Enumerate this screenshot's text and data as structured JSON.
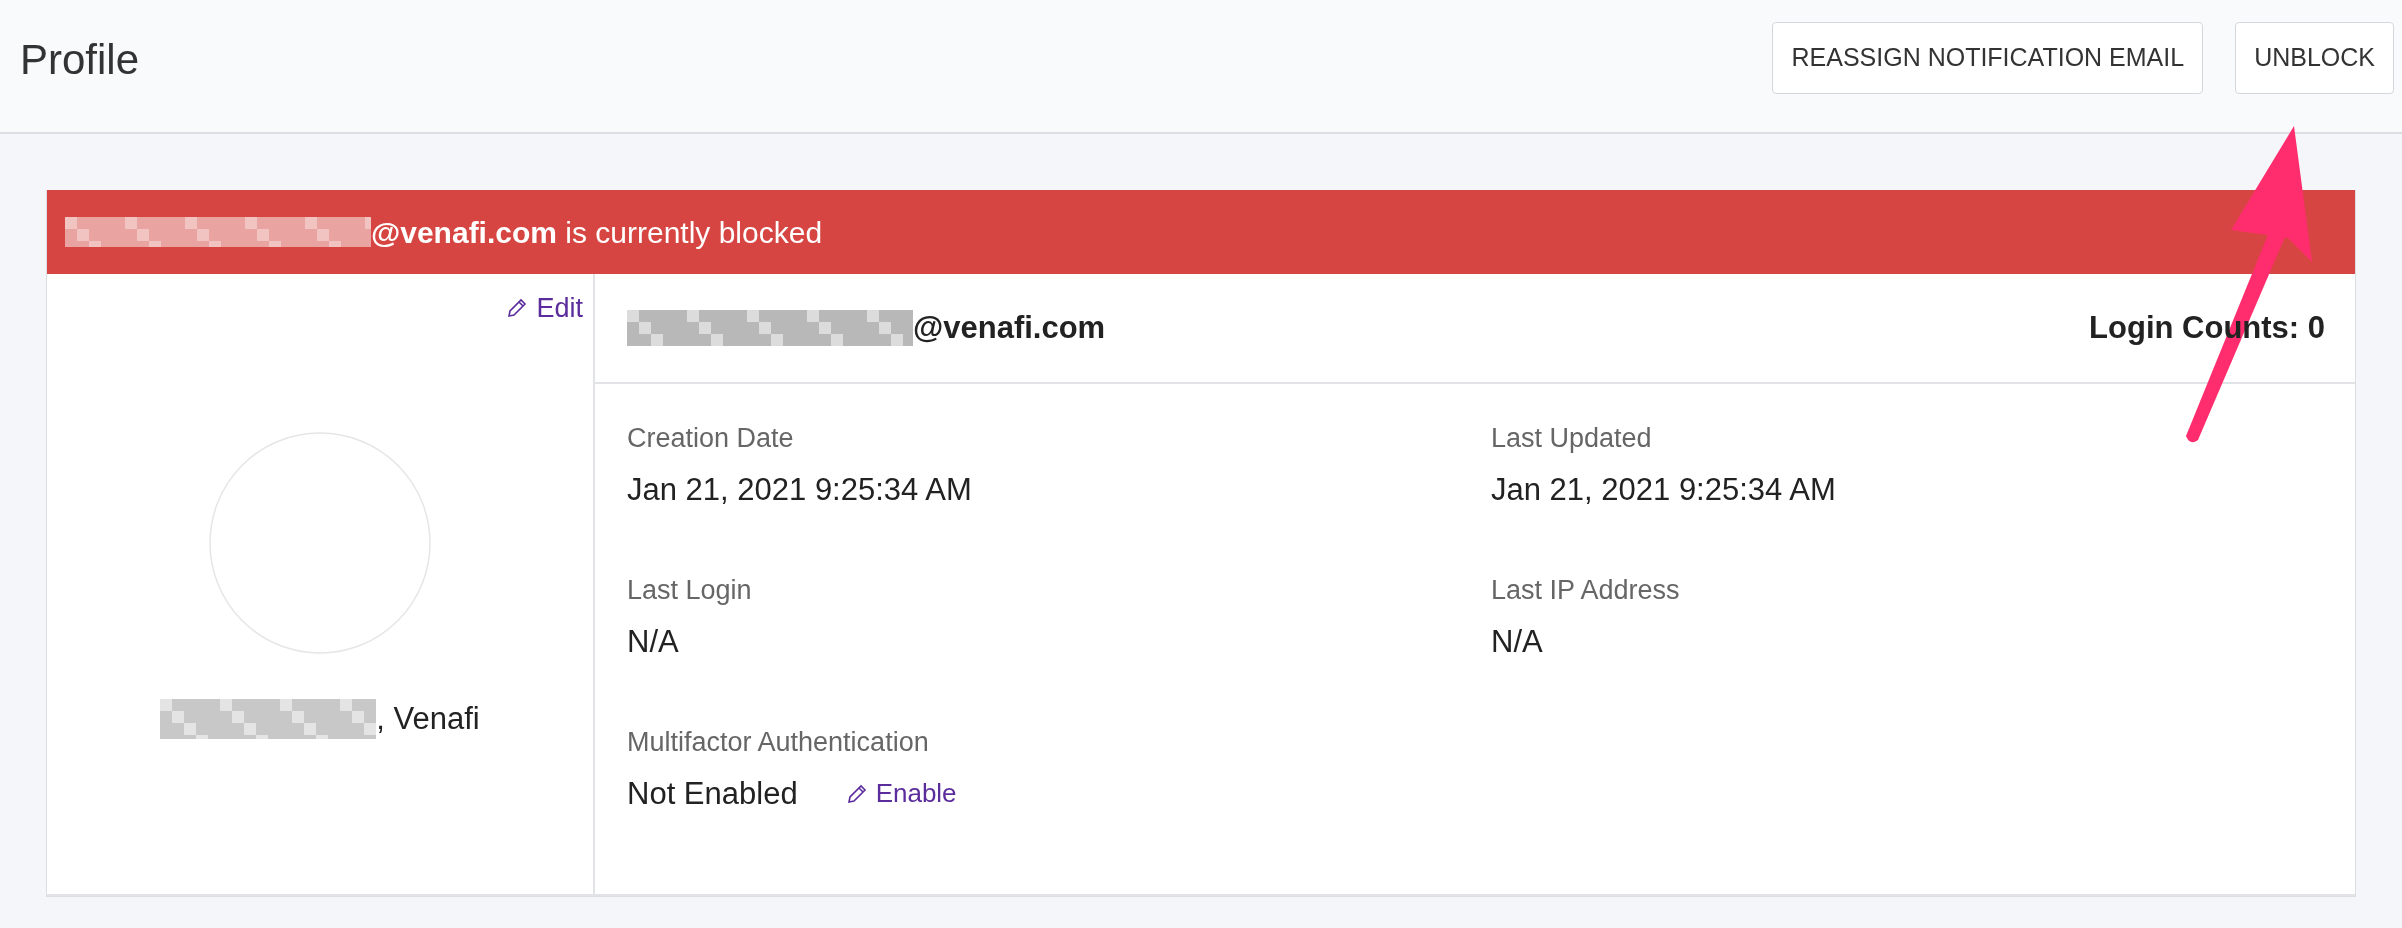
{
  "header": {
    "title": "Profile",
    "buttons": [
      "REASSIGN NOTIFICATION EMAIL",
      "UNBLOCK"
    ]
  },
  "banner": {
    "text": "**@venafi.com** is currently blocked"
  },
  "profile": {
    "edit_link": "Edit",
    "name_suffix": ", Venafi"
  },
  "details": {
    "email_suffix": "@venafi.com",
    "login_counts": "Login Counts: 0",
    "fields": [
      {
        "label": "Creation Date",
        "value": "Jan 21, 2021 9:25:34 AM"
      },
      {
        "label": "Last Updated",
        "value": "Jan 21, 2021 9:25:34 AM"
      },
      {
        "label": "Last Login",
        "value": "N/A"
      },
      {
        "label": "Last IP Address",
        "value": "N/A"
      },
      {
        "label": "Multifactor Authentication",
        "value": "Not Enabled",
        "action": "Enable"
      }
    ]
  }
}
